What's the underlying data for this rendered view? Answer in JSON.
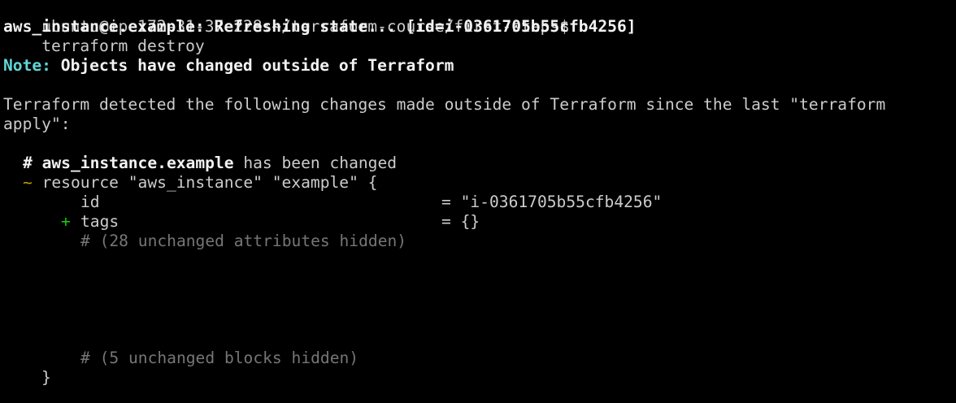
{
  "terminal": {
    "prompt": "ubuntu@ip-172-31-37-228:~/terraform-course/first-steps$",
    "command": "terraform destroy",
    "refreshing": "aws_instance.example: Refreshing state... [id=i-0361705b55cfb4256]",
    "note_label": "Note:",
    "note_text": " Objects have changed outside of Terraform",
    "detected_line1": "Terraform detected the following changes made outside of Terraform since the last \"terraform",
    "detected_line2": "apply\":",
    "changed_hash": "#",
    "changed_resource": "aws_instance.example",
    "changed_suffix": "has been changed",
    "tilde": "~",
    "resource_open": "resource \"aws_instance\" \"example\" {",
    "id_key": "id",
    "id_value": "= \"i-0361705b55cfb4256\"",
    "plus": "+",
    "tags_key": "tags",
    "tags_value": "= {}",
    "hidden_attrs": "# (28 unchanged attributes hidden)",
    "hidden_blocks": "# (5 unchanged blocks hidden)",
    "close_brace": "}"
  },
  "colors": {
    "background": "#000000",
    "text": "#cccccc",
    "note": "#61d6d6",
    "added": "#16c60c",
    "changed": "#c19c00",
    "comment": "#767676"
  }
}
